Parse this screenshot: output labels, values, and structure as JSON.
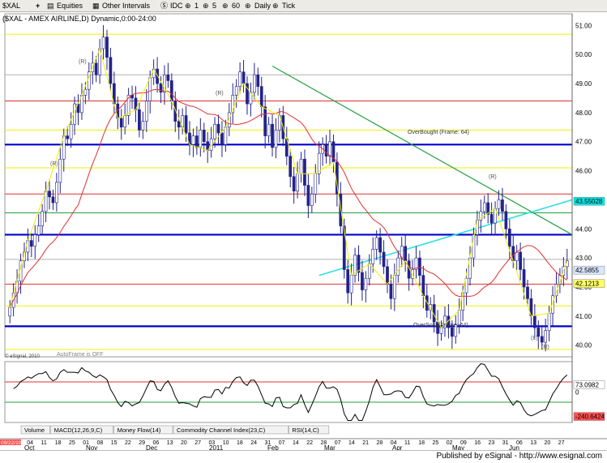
{
  "toolbar": {
    "symbol_label": "$XAL",
    "items": [
      "Equities",
      "Other Intervals",
      "IDC",
      "1",
      "5",
      "60",
      "Daily",
      "Tick"
    ]
  },
  "chart_data": {
    "type": "candlestick",
    "title": "($XAL - AMEX AIRLINE,D) Dynamic,0:00-24:00",
    "y_ticks": [
      40.0,
      41.0,
      42.0,
      43.0,
      44.0,
      45.0,
      46.0,
      47.0,
      48.0,
      49.0,
      50.0,
      51.0
    ],
    "ylim": [
      39.6,
      51.4
    ],
    "x_day_labels": [
      "27",
      "04",
      "11",
      "18",
      "25",
      "01",
      "08",
      "15",
      "22",
      "29",
      "06",
      "13",
      "20",
      "27",
      "03",
      "10",
      "18",
      "24",
      "31",
      "07",
      "14",
      "22",
      "28",
      "07",
      "14",
      "21",
      "28",
      "04",
      "11",
      "18",
      "25",
      "02",
      "09",
      "16",
      "23",
      "31",
      "06",
      "13",
      "20",
      "27"
    ],
    "x_month_labels": [
      "Oct",
      "Nov",
      "Dec",
      "2011",
      "Feb",
      "Mar",
      "Apr",
      "May",
      "Jun"
    ],
    "start_date_label": "09/22/10",
    "price_markers": [
      {
        "label": "43.55028",
        "value": 44.95,
        "bg": "#00e6e6"
      },
      {
        "label": "42.5855",
        "value": 42.58,
        "bg": "#d9e6ff"
      },
      {
        "label": "42.1213",
        "value": 42.12,
        "bg": "#ffff66"
      },
      {
        "label": "73.0982",
        "value": 73.0982,
        "bg": "#ffffff"
      },
      {
        "label": "-240.6424",
        "value": -240.6424,
        "bg": "#ff5050"
      }
    ],
    "annotations": [
      "OverBought (Frame: 64)",
      "OverSold (Frame: 64)",
      "AutoFrame is OFF",
      "(R)",
      "(R)",
      "(R)",
      "(R)",
      "(L)",
      "(R)"
    ],
    "copyright": "© eSignal, 2010",
    "indicator_tabs": [
      "Volume",
      "MACD(12,26,9,C)",
      "Money Flow(14)",
      "Commodity Channel Index(23,C)",
      "RSI(14,C)"
    ],
    "colors": {
      "up": "#ffffff",
      "down": "#22228c",
      "ma": "#e03030",
      "frame": "#f0f000",
      "trend": "#22a040",
      "cyan": "#30e0e0"
    },
    "close_series": [
      41.3,
      41.8,
      42.2,
      42.9,
      43.2,
      43.6,
      43.4,
      43.8,
      44.1,
      44.6,
      45.3,
      45.1,
      44.9,
      45.6,
      46.4,
      47.2,
      47.1,
      47.6,
      48.3,
      48.0,
      48.6,
      48.8,
      49.4,
      49.7,
      49.3,
      50.2,
      50.6,
      49.9,
      49.0,
      48.3,
      47.8,
      47.5,
      47.9,
      48.6,
      48.5,
      48.1,
      47.4,
      47.7,
      48.4,
      49.2,
      49.5,
      49.0,
      48.7,
      49.3,
      49.1,
      48.4,
      47.7,
      47.5,
      47.9,
      47.3,
      46.9,
      47.2,
      46.8,
      47.4,
      47.0,
      46.7,
      47.1,
      47.6,
      47.3,
      46.9,
      47.5,
      48.0,
      48.6,
      48.9,
      49.4,
      49.0,
      48.3,
      48.7,
      49.3,
      48.9,
      48.2,
      47.2,
      47.6,
      46.8,
      47.4,
      47.9,
      47.1,
      46.5,
      45.8,
      45.3,
      45.9,
      46.4,
      45.5,
      44.8,
      45.2,
      45.9,
      46.6,
      46.9,
      46.5,
      47.0,
      46.3,
      45.2,
      44.1,
      42.6,
      41.8,
      42.4,
      43.1,
      42.5,
      41.9,
      42.3,
      42.8,
      43.3,
      43.7,
      43.2,
      42.7,
      42.1,
      41.6,
      42.4,
      43.0,
      43.4,
      42.9,
      42.3,
      42.6,
      43.0,
      42.4,
      41.7,
      41.2,
      41.4,
      40.8,
      40.4,
      40.6,
      41.0,
      40.6,
      40.3,
      40.7,
      41.2,
      41.8,
      42.3,
      43.0,
      43.8,
      44.3,
      44.6,
      44.9,
      44.5,
      44.2,
      44.7,
      45.0,
      44.6,
      44.0,
      43.4,
      42.9,
      43.2,
      42.6,
      42.0,
      41.6,
      41.0,
      40.6,
      40.3,
      40.1,
      40.5,
      41.1,
      41.7,
      42.1,
      42.4,
      42.7,
      42.9
    ],
    "open_series": [
      41.0,
      41.3,
      41.8,
      42.2,
      42.9,
      43.2,
      43.6,
      43.4,
      43.8,
      44.1,
      44.6,
      45.3,
      45.1,
      44.9,
      45.6,
      46.4,
      47.2,
      47.1,
      47.6,
      48.3,
      48.0,
      48.6,
      48.8,
      49.4,
      49.7,
      49.3,
      50.2,
      50.6,
      49.9,
      49.0,
      48.3,
      47.8,
      47.5,
      47.9,
      48.6,
      48.5,
      48.1,
      47.4,
      47.7,
      48.4,
      49.2,
      49.5,
      49.0,
      48.7,
      49.3,
      49.1,
      48.4,
      47.7,
      47.5,
      47.9,
      47.3,
      46.9,
      47.2,
      46.8,
      47.4,
      47.0,
      46.7,
      47.1,
      47.6,
      47.3,
      46.9,
      47.5,
      48.0,
      48.6,
      48.9,
      49.4,
      49.0,
      48.3,
      48.7,
      49.3,
      48.9,
      48.2,
      47.2,
      47.6,
      46.8,
      47.4,
      47.9,
      47.1,
      46.5,
      45.8,
      45.3,
      45.9,
      46.4,
      45.5,
      44.8,
      45.2,
      45.9,
      46.6,
      46.9,
      46.5,
      47.0,
      46.3,
      45.2,
      44.1,
      42.6,
      41.8,
      42.4,
      43.1,
      42.5,
      41.9,
      42.3,
      42.8,
      43.3,
      43.7,
      43.2,
      42.7,
      42.1,
      41.6,
      42.4,
      43.0,
      43.4,
      42.9,
      42.3,
      42.6,
      43.0,
      42.4,
      41.7,
      41.2,
      41.4,
      40.8,
      40.4,
      40.6,
      41.0,
      40.6,
      40.3,
      40.7,
      41.2,
      41.8,
      42.3,
      43.0,
      43.8,
      44.3,
      44.6,
      44.9,
      44.5,
      44.2,
      44.7,
      45.0,
      44.6,
      44.0,
      43.4,
      42.9,
      43.2,
      42.6,
      42.0,
      41.6,
      41.0,
      40.6,
      40.3,
      40.1,
      40.5,
      41.1,
      41.7,
      42.1,
      42.4,
      42.7
    ],
    "horizontal_levels": [
      {
        "value": 50.7,
        "color": "#f0f000"
      },
      {
        "value": 49.3,
        "color": "#b0b0b0"
      },
      {
        "value": 48.4,
        "color": "#e03030"
      },
      {
        "value": 47.4,
        "color": "#f0f000"
      },
      {
        "value": 46.9,
        "color": "#0000cc"
      },
      {
        "value": 46.1,
        "color": "#f0f000"
      },
      {
        "value": 45.2,
        "color": "#e03030"
      },
      {
        "value": 44.55,
        "color": "#22a040"
      },
      {
        "value": 43.8,
        "color": "#0000cc"
      },
      {
        "value": 42.95,
        "color": "#b0b0b0"
      },
      {
        "value": 42.1,
        "color": "#e03030"
      },
      {
        "value": 41.35,
        "color": "#f0f000"
      },
      {
        "value": 40.65,
        "color": "#0000cc"
      },
      {
        "value": 39.85,
        "color": "#f0f000"
      }
    ],
    "rsi_ylim": [
      -300,
      300
    ],
    "rsi_ticks": [
      0
    ],
    "rsi_levels": [
      {
        "value": 100,
        "color": "#e03030"
      },
      {
        "value": -100,
        "color": "#22a040"
      }
    ]
  },
  "footer": {
    "published": "Published by eSignal - http://www.esignal.com"
  }
}
